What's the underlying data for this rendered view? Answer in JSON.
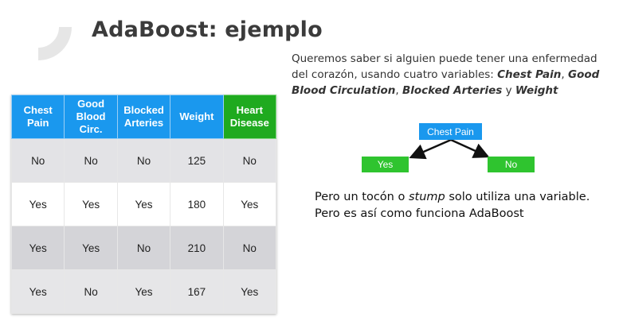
{
  "slide": {
    "title": "AdaBoost: ejemplo",
    "intro": {
      "part1": "Queremos saber si alguien puede tener una enfermedad del corazón, usando cuatro variables: ",
      "var1": "Chest Pain",
      "sep1": ", ",
      "var2": "Good Blood Circulation",
      "sep2": ", ",
      "var3": "Blocked Arteries",
      "sep3": " y ",
      "var4": "Weight"
    },
    "note": {
      "line1_a": "Pero un tocón o ",
      "line1_em": "stump",
      "line1_b": " solo utiliza una variable.",
      "line2": "Pero es así como funciona AdaBoost"
    }
  },
  "table": {
    "headers": [
      "Chest Pain",
      "Good Blood Circ.",
      "Blocked Arteries",
      "Weight",
      "Heart Disease"
    ],
    "rows": [
      [
        "No",
        "No",
        "No",
        "125",
        "No"
      ],
      [
        "Yes",
        "Yes",
        "Yes",
        "180",
        "Yes"
      ],
      [
        "Yes",
        "Yes",
        "No",
        "210",
        "No"
      ],
      [
        "Yes",
        "No",
        "Yes",
        "167",
        "Yes"
      ]
    ]
  },
  "stump": {
    "root": "Chest Pain",
    "left": "Yes",
    "right": "No"
  },
  "colors": {
    "header_blue": "#1a98ee",
    "header_green": "#1faa1f",
    "leaf_green": "#2fc42f"
  }
}
